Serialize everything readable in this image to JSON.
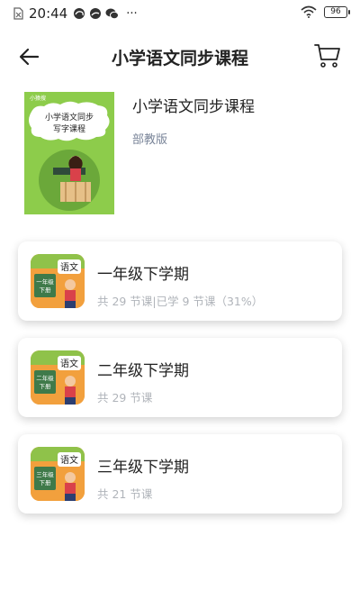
{
  "status_bar": {
    "time": "20:44",
    "notification_icons": [
      "sim-icon",
      "cloud-icon",
      "cloud-icon",
      "wechat-icon"
    ],
    "more": "···",
    "battery": "96"
  },
  "nav": {
    "title": "小学语文同步课程",
    "back_icon": "arrow-left-icon",
    "cart_icon": "cart-icon"
  },
  "course": {
    "title": "小学语文同步课程",
    "edition": "部教版",
    "cover": {
      "brand": "小猿搜",
      "line1": "小学语文同步",
      "line2": "写字课程"
    }
  },
  "terms": [
    {
      "name": "一年级下学期",
      "meta": "共 29 节课|已学 9 节课（31%）",
      "thumb_label": "一年级\n下册",
      "thumb_tag": "语文"
    },
    {
      "name": "二年级下学期",
      "meta": "共 29 节课",
      "thumb_label": "二年级\n下册",
      "thumb_tag": "语文"
    },
    {
      "name": "三年级下学期",
      "meta": "共 21 节课",
      "thumb_label": "三年级\n下册",
      "thumb_tag": "语文"
    }
  ],
  "colors": {
    "cover_green": "#8dcc4b",
    "thumb_orange": "#f2a03d",
    "meta_gray": "#b0b4ba",
    "edition_gray": "#7a8599"
  }
}
